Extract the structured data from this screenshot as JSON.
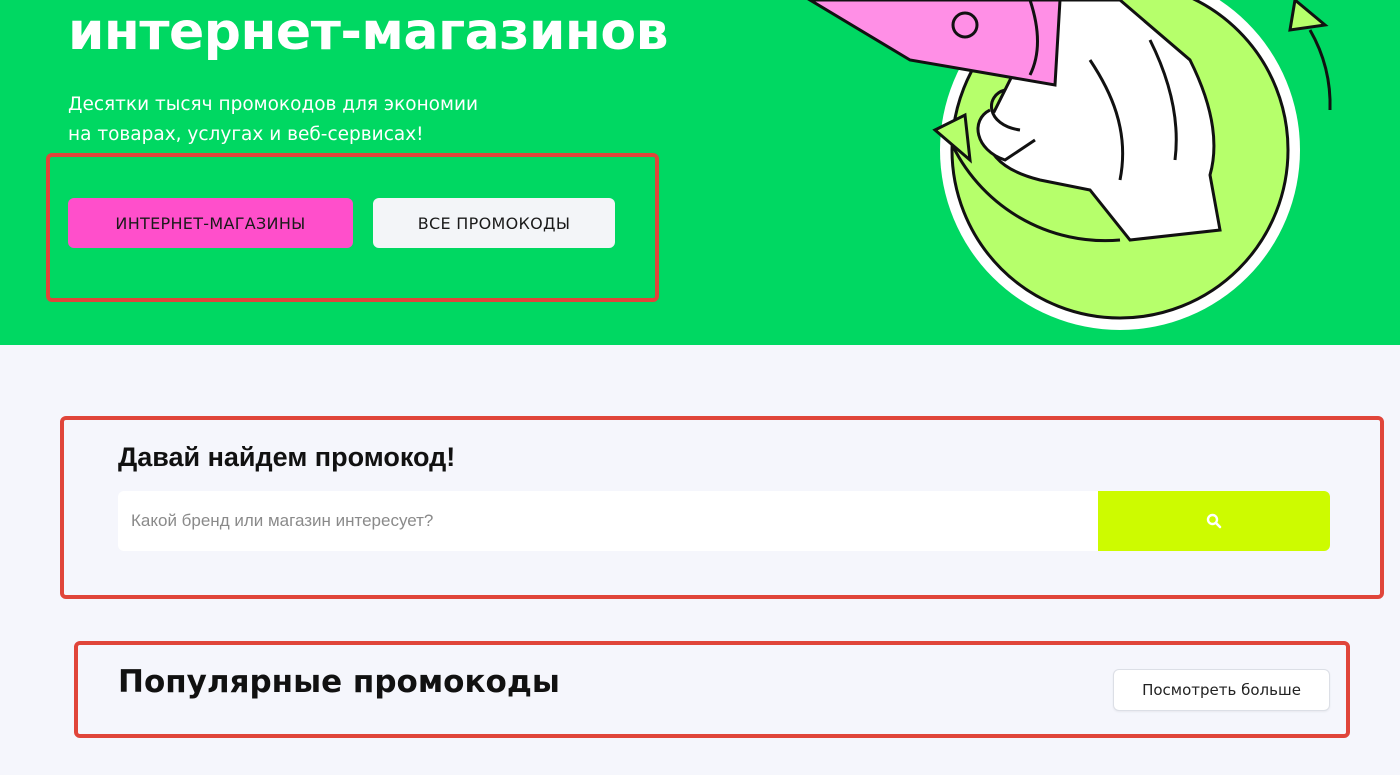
{
  "hero": {
    "title": "интернет-магазинов",
    "subtitle_line1": "Десятки тысяч промокодов для экономии",
    "subtitle_line2": "на товарах, услугах и веб-сервисах!",
    "buttons": {
      "shops_label": "ИНТЕРНЕТ-МАГАЗИНЫ",
      "all_promocodes_label": "ВСЕ ПРОМОКОДЫ"
    },
    "illustration_icon": "hand-holding-coupon-illustration"
  },
  "search": {
    "title": "Давай найдем промокод!",
    "placeholder": "Какой бренд или магазин интересует?",
    "value": "",
    "button_icon": "search-icon"
  },
  "popular": {
    "title": "Популярные промокоды",
    "more_label": "Посмотреть больше"
  },
  "colors": {
    "hero_bg": "#00d862",
    "page_bg": "#f5f6fc",
    "shops_button": "#ff4fcb",
    "search_button": "#cdfb00",
    "highlight_frame": "#e0453a"
  }
}
